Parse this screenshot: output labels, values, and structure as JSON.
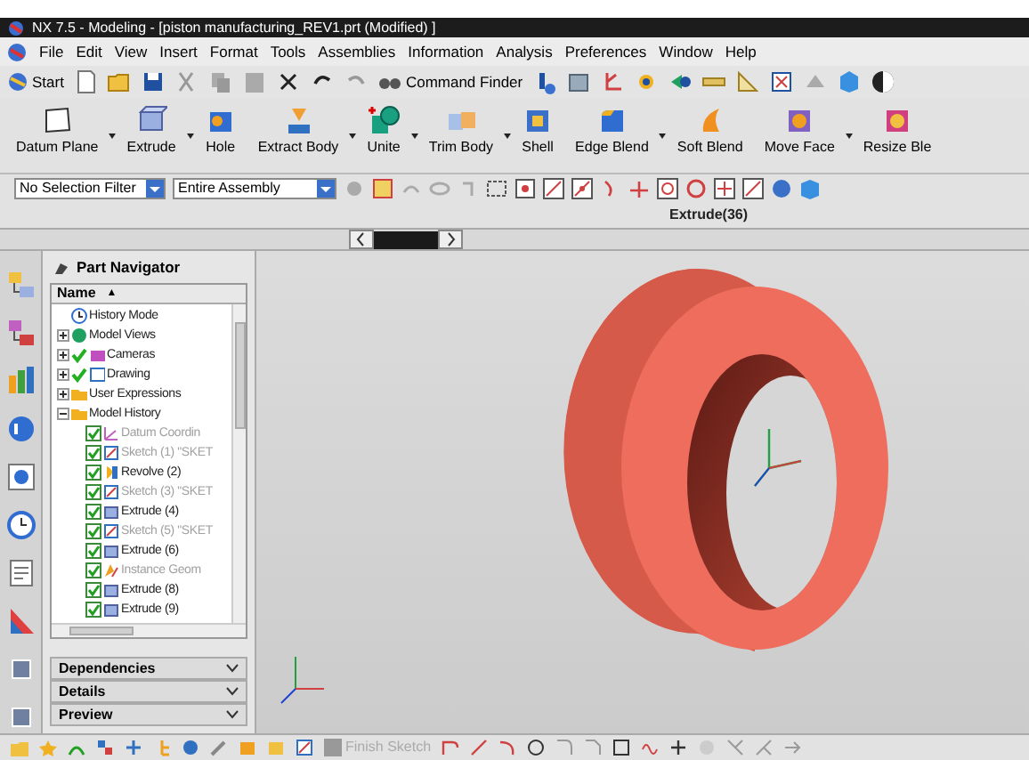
{
  "window": {
    "title": "NX 7.5 - Modeling - [piston manufacturing_REV1.prt (Modified) ]"
  },
  "menu": [
    "File",
    "Edit",
    "View",
    "Insert",
    "Format",
    "Tools",
    "Assemblies",
    "Information",
    "Analysis",
    "Preferences",
    "Window",
    "Help"
  ],
  "standard_toolbar": {
    "start": "Start",
    "command_finder": "Command Finder"
  },
  "feature_toolbar": [
    {
      "label": "Datum Plane",
      "dropdown": true,
      "kind": "plane"
    },
    {
      "label": "Extrude",
      "dropdown": true,
      "kind": "extrude"
    },
    {
      "label": "Hole",
      "dropdown": false,
      "kind": "hole"
    },
    {
      "label": "Extract Body",
      "dropdown": true,
      "kind": "extract"
    },
    {
      "label": "Unite",
      "dropdown": true,
      "kind": "unite"
    },
    {
      "label": "Trim Body",
      "dropdown": true,
      "kind": "trim"
    },
    {
      "label": "Shell",
      "dropdown": false,
      "kind": "shell"
    },
    {
      "label": "Edge Blend",
      "dropdown": true,
      "kind": "blend"
    },
    {
      "label": "Soft Blend",
      "dropdown": false,
      "kind": "soft"
    },
    {
      "label": "Move Face",
      "dropdown": true,
      "kind": "move"
    },
    {
      "label": "Resize Ble",
      "dropdown": false,
      "kind": "resize"
    }
  ],
  "selection_bar": {
    "filter": "No Selection Filter",
    "scope": "Entire Assembly"
  },
  "feature_label": "Extrude(36)",
  "navigator": {
    "title": "Part Navigator",
    "column": "Name",
    "sort": "▲",
    "tree": [
      {
        "label": "History Mode",
        "kind": "clock"
      },
      {
        "label": "Model Views",
        "kind": "views",
        "expanded": false
      },
      {
        "label": "Cameras",
        "kind": "camera",
        "expanded": false,
        "checked": true
      },
      {
        "label": "Drawing",
        "kind": "drawing",
        "expanded": false,
        "checked": true
      },
      {
        "label": "User Expressions",
        "kind": "folder",
        "expanded": false
      },
      {
        "label": "Model History",
        "kind": "folder",
        "expanded": true,
        "children": [
          {
            "label": "Datum Coordin",
            "kind": "datum",
            "checked": true,
            "greyed": true
          },
          {
            "label": "Sketch (1) \"SKET",
            "kind": "sketch",
            "checked": true,
            "greyed": true
          },
          {
            "label": "Revolve (2)",
            "kind": "revolve",
            "checked": true,
            "greyed": false
          },
          {
            "label": "Sketch (3) \"SKET",
            "kind": "sketch",
            "checked": true,
            "greyed": true
          },
          {
            "label": "Extrude (4)",
            "kind": "extrude",
            "checked": true,
            "greyed": false
          },
          {
            "label": "Sketch (5) \"SKET",
            "kind": "sketch",
            "checked": true,
            "greyed": true
          },
          {
            "label": "Extrude (6)",
            "kind": "extrude",
            "checked": true,
            "greyed": false
          },
          {
            "label": "Instance Geom",
            "kind": "instance",
            "checked": true,
            "greyed": true
          },
          {
            "label": "Extrude (8)",
            "kind": "extrude",
            "checked": true,
            "greyed": false
          },
          {
            "label": "Extrude (9)",
            "kind": "extrude",
            "checked": true,
            "greyed": false
          }
        ]
      }
    ]
  },
  "panels": [
    {
      "label": "Dependencies",
      "expanded": false
    },
    {
      "label": "Details",
      "expanded": false
    },
    {
      "label": "Preview",
      "expanded": false
    }
  ],
  "sketch_toolbar": {
    "finish_sketch": "Finish Sketch",
    "disabled": true
  }
}
